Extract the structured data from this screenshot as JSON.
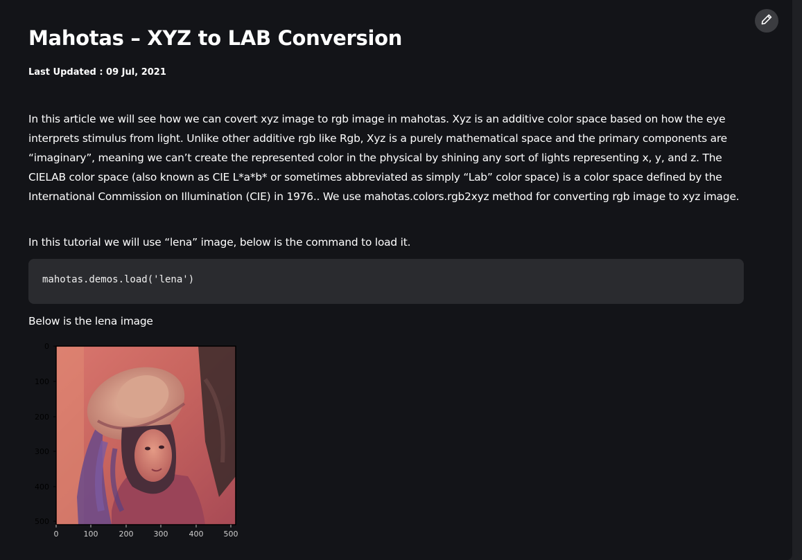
{
  "article": {
    "title": "Mahotas – XYZ to LAB Conversion",
    "last_updated": "Last Updated : 09 Jul, 2021",
    "intro_paragraph": "In this article we will see how we can covert xyz image to rgb image in mahotas. Xyz is an additive color space based on how the eye interprets stimulus from light. Unlike other additive rgb like Rgb, Xyz is a purely mathematical space and the primary components are “imaginary”, meaning we can’t create the represented color in the physical by shining any sort of lights representing x, y, and z. The CIELAB color space (also known as CIE L*a*b* or sometimes abbreviated as simply “Lab” color space) is a color space defined by the International Commission on Illumination (CIE) in 1976.. We use mahotas.colors.rgb2xyz method for converting rgb image to xyz image.",
    "tutorial_paragraph": "In this tutorial we will use “lena” image, below is the command to load it.",
    "code_snippet": "mahotas.demos.load('lena')",
    "image_caption": "Below is the lena image"
  },
  "toolbar": {
    "edit_icon": "pencil-icon"
  },
  "figure": {
    "y_ticks": [
      "0",
      "100",
      "200",
      "300",
      "400",
      "500"
    ],
    "x_ticks": [
      "0",
      "100",
      "200",
      "300",
      "400",
      "500"
    ]
  },
  "colors": {
    "background": "#131418",
    "text": "#ffffff",
    "code_bg": "#2a2b2f",
    "edit_btn_bg": "#3b3c40"
  }
}
